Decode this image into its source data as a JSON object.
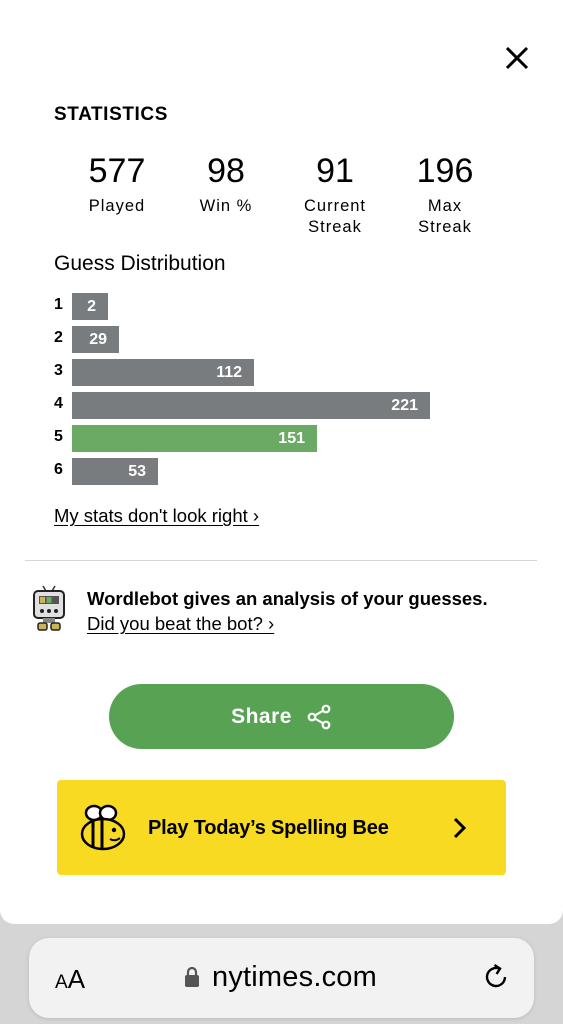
{
  "modal": {
    "title": "STATISTICS",
    "close_icon": "close-icon",
    "stats": [
      {
        "value": "577",
        "label": "Played"
      },
      {
        "value": "98",
        "label": "Win %"
      },
      {
        "value": "91",
        "label": "Current\nStreak"
      },
      {
        "value": "196",
        "label": "Max\nStreak"
      }
    ],
    "distribution": {
      "title": "Guess Distribution",
      "rows": [
        {
          "guess": "1",
          "count": "2",
          "fraction": 0.009
        },
        {
          "guess": "2",
          "count": "29",
          "fraction": 0.131
        },
        {
          "guess": "3",
          "count": "112",
          "fraction": 0.507
        },
        {
          "guess": "4",
          "count": "221",
          "fraction": 1.0
        },
        {
          "guess": "5",
          "count": "151",
          "fraction": 0.683,
          "highlight": true
        },
        {
          "guess": "6",
          "count": "53",
          "fraction": 0.24
        }
      ],
      "bar_color": "#787c7e",
      "highlight_color": "#6aaa64"
    },
    "stats_link": "My stats don't look right ›",
    "wordlebot": {
      "icon": "wordlebot-icon",
      "headline": "Wordlebot gives an analysis of your guesses.",
      "link": "Did you beat the bot? ›"
    },
    "share": {
      "label": "Share",
      "icon": "share-icon",
      "color": "#57a353"
    },
    "spelling_bee": {
      "label": "Play Today’s Spelling Bee",
      "icon": "bee-icon",
      "chevron": "chevron-right-icon",
      "color": "#f7da21"
    }
  },
  "browser": {
    "text_size_label_small": "A",
    "text_size_label_large": "A",
    "url": "nytimes.com",
    "lock_icon": "lock-icon",
    "reload_icon": "reload-icon"
  }
}
